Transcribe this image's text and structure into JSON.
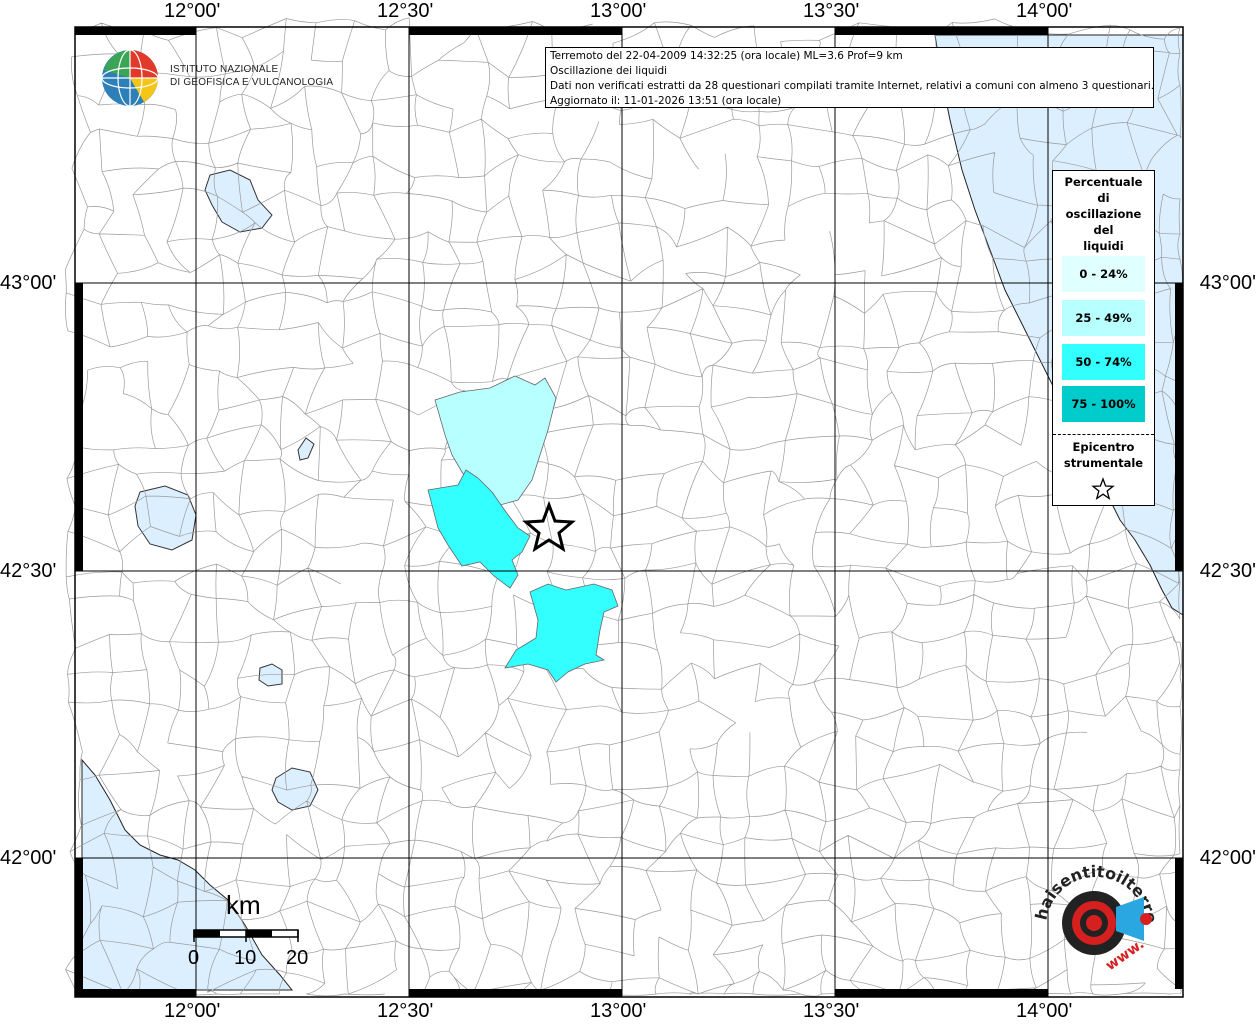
{
  "header": {
    "line1": "Terremoto del 22-04-2009 14:32:25 (ora locale) ML=3.6 Prof=9 km",
    "line2": "Oscillazione dei liquidi",
    "line3": "Dati non verificati estratti da 28 questionari compilati tramite Internet, relativi a comuni con almeno 3 questionari.",
    "line4": "Aggiornato il: 11-01-2026 13:51 (ora locale)"
  },
  "institute": {
    "line1": "ISTITUTO NAZIONALE",
    "line2": "DI GEOFISICA E VULCANOLOGIA"
  },
  "legend": {
    "title": [
      "Percentuale",
      "di",
      "oscillazione",
      "del",
      "liquidi"
    ],
    "classes": [
      {
        "label": "0 - 24%",
        "color": "#e0ffff"
      },
      {
        "label": "25 - 49%",
        "color": "#b8ffff"
      },
      {
        "label": "50 - 74%",
        "color": "#33ffff"
      },
      {
        "label": "75 - 100%",
        "color": "#00cccc"
      }
    ],
    "epicenter_label": [
      "Epicentro",
      "strumentale"
    ]
  },
  "axes": {
    "lon_ticks": [
      "12°00'",
      "12°30'",
      "13°00'",
      "13°30'",
      "14°00'"
    ],
    "lat_ticks": [
      "43°00'",
      "42°30'",
      "42°00'"
    ]
  },
  "scale": {
    "unit": "km",
    "labels": [
      "0",
      "10",
      "20"
    ]
  },
  "logo_haisentito": {
    "text1": "haisentitoilterremoto.it",
    "text2": "www."
  },
  "colors": {
    "sea": "#dcefff",
    "lake": "#dcefff",
    "land": "#ffffff",
    "boundary": "#9a9a9a"
  },
  "features": {
    "municipalities": [
      {
        "name": "area-north",
        "class": "25 - 49%"
      },
      {
        "name": "area-west",
        "class": "50 - 74%"
      },
      {
        "name": "area-south",
        "class": "50 - 74%"
      }
    ]
  }
}
